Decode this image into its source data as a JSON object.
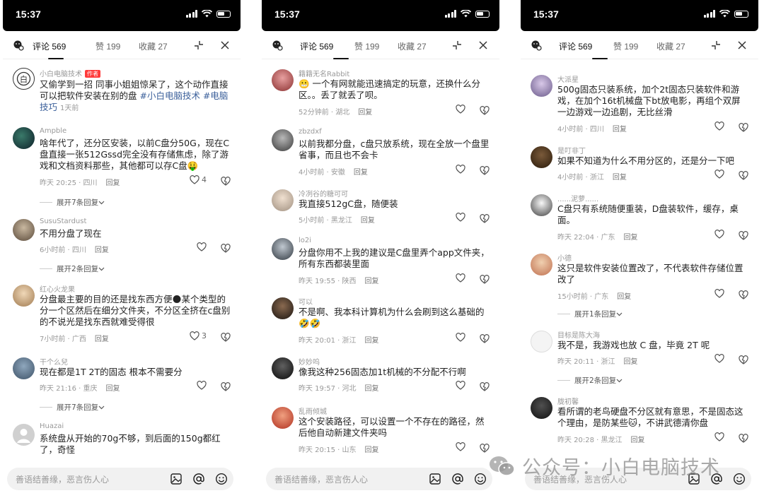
{
  "status": {
    "time": "15:37"
  },
  "tabs": {
    "comments": "评论 569",
    "likes": "赞 199",
    "favorites": "收藏 27"
  },
  "input": {
    "placeholder": "善语结善缘，恶言伤人心"
  },
  "watermark": "公众号：小白电脑技术",
  "colors": {
    "author_tag": "#ff3b3b",
    "hashtag": "#3a5f9a",
    "meta_gray": "#999999"
  },
  "phone1": {
    "c1": {
      "user": "小白电脑技术",
      "tag": "作者",
      "text": "又偷学到一招 同事小姐姐惊呆了，这个动作直接可以把软件安装在别的盘",
      "hashtag": "#小白电脑技术 #电脑技巧",
      "time": "1天前"
    },
    "c2": {
      "user": "Ampble",
      "text": "啥年代了，还分区安装，以前C盘分50G，现在C盘直接一张512Gssd完全没有存储焦虑，除了游戏和文档资料那些，其他都可以存C盘🤑",
      "meta": "昨天 20:25 · 四川",
      "reply": "回复",
      "likes": "4",
      "expand": "展开7条回复"
    },
    "c3": {
      "user": "SusuStardust",
      "text": "不用分盘了现在",
      "meta": "6小时前 · 四川",
      "reply": "回复",
      "expand": "展开2条回复"
    },
    "c4": {
      "user": "红心火龙果",
      "text": "分盘最主要的目的还是找东西方便🌑某个类型的分一个区然后在细分文件夹，不分区全挤在c盘别的不说光是找东西就难受得很",
      "meta": "7小时前 · 广西",
      "reply": "回复",
      "likes": "3"
    },
    "c5": {
      "user": "干个么兒",
      "text": "现在都是1T 2T的固态  根本不需要分",
      "meta": "昨天 21:16 · 重庆",
      "reply": "回复",
      "expand": "展开7条回复"
    },
    "c6": {
      "user": "Huazai",
      "text": "系统盘从开始的70g不够，到后面的150g都红了，奇怪"
    }
  },
  "phone2": {
    "c1": {
      "user": "籍籍无名Rabbit",
      "text": "😬 一个有网就能迅速搞定的玩意，还换什么分区。。丢了就丢了呗。",
      "meta": "52分钟前 · 湖北",
      "reply": "回复"
    },
    "c2": {
      "user": "zbzdxf",
      "text": "以前我都分盘，c盘只放系统，现在全放一个盘里省事，而且也不会卡",
      "meta": "4小时前 · 安徽",
      "reply": "回复"
    },
    "c3": {
      "user": "冷冽谷的糖可可",
      "text": "我直接512gC盘，随便装",
      "meta": "5小时前 · 黑龙江",
      "reply": "回复"
    },
    "c4": {
      "user": "lo2i",
      "text": "分盘你用不上我的建议是C盘里弄个app文件夹，所有东西都装里面",
      "meta": "昨天 19:55 · 陕西",
      "reply": "回复"
    },
    "c5": {
      "user": "可以",
      "text": "不是啊、我本科计算机为什么会刷到这么基础的🤣🤣",
      "meta": "昨天 20:01 · 浙江",
      "reply": "回复"
    },
    "c6": {
      "user": "妙妙呜",
      "text": "像我这种256固态加1t机械的不分配不行啊",
      "meta": "昨天 19:57 · 河北",
      "reply": "回复"
    },
    "c7": {
      "user": "乱雨倾城",
      "text": "这个安装路径，可以设置一个不存在的路径，然后他自动新建文件夹吗",
      "meta": "昨天 20:15 · 山东",
      "reply": "回复"
    }
  },
  "phone3": {
    "c1": {
      "user": "大派星",
      "text": "500g固态只装系统，加个2t固态只装软件和游戏，在加个16t机械盘下bt放电影，再组个双屏一边游戏一边追剧，无比丝滑",
      "meta": "4小时前 · 四川",
      "reply": "回复"
    },
    "c2": {
      "user": "是叮非丁",
      "text": "如果不知道为什么不用分区的，还是分一下吧",
      "meta": "4小时前 · 浙江",
      "reply": "回复"
    },
    "c3": {
      "user": "......泥萝......",
      "text": "C盘只有系统随便重装，D盘装软件，缓存，桌面。",
      "meta": "昨天 22:04 · 广东",
      "reply": "回复"
    },
    "c4": {
      "user": "小德",
      "text": "这只是软件安装位置改了，不代表软件存储位置改了",
      "meta": "15小时前 · 广东",
      "reply": "回复",
      "expand": "展开1条回复"
    },
    "c5": {
      "user": "目标是陈大海",
      "text": "我不是，我游戏也放 C 盘，毕竟 2T 呢",
      "meta": "昨天 20:11 · 浙江",
      "reply": "回复",
      "expand": "展开2条回复"
    },
    "c6": {
      "user": "胧初馨",
      "text": "看所谓的老鸟硬盘不分区就有意思，不是固态这个理由，是防某些🐱，不讲武德清你盘",
      "meta": "昨天 20:28 · 黑龙江",
      "reply": "回复"
    }
  }
}
